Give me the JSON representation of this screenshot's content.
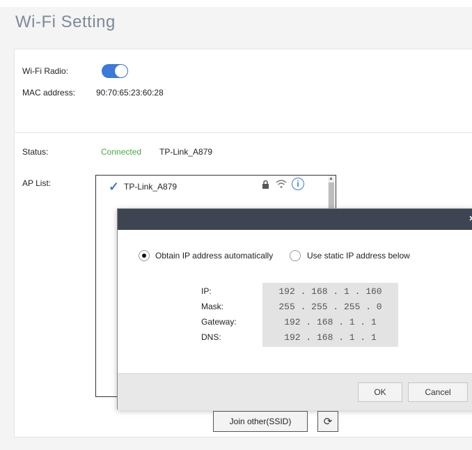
{
  "page": {
    "title": "Wi-Fi Setting"
  },
  "wifi": {
    "radio_label": "Wi-Fi Radio:",
    "radio_on": true,
    "mac_label": "MAC address:",
    "mac_value": "90:70:65:23:60:28"
  },
  "status": {
    "label": "Status:",
    "state": "Connected",
    "ssid": "TP-Link_A879"
  },
  "ap_list": {
    "label": "AP List:",
    "items": [
      {
        "name": "TP-Link_A879",
        "connected": true,
        "icons": [
          "lock-icon",
          "wifi-signal-icon",
          "info-icon"
        ]
      }
    ]
  },
  "dialog": {
    "option_auto": "Obtain IP address automatically",
    "option_static": "Use static IP address below",
    "selected": "auto",
    "fields": {
      "ip_label": "IP:",
      "mask_label": "Mask:",
      "gateway_label": "Gateway:",
      "dns_label": "DNS:",
      "ip_value": "192 . 168 .  1  . 160",
      "mask_value": "255 . 255 . 255 .  0",
      "gateway_value": "192 . 168 .  1  .  1",
      "dns_value": "192 . 168 .  1  .  1"
    },
    "ok_label": "OK",
    "cancel_label": "Cancel",
    "close_label": "×"
  },
  "buttons": {
    "join_other": "Join other(SSID)"
  },
  "colors": {
    "toggle_on": "#3b7ad9",
    "connected": "#4aa84a",
    "dialog_header": "#3d4552"
  }
}
